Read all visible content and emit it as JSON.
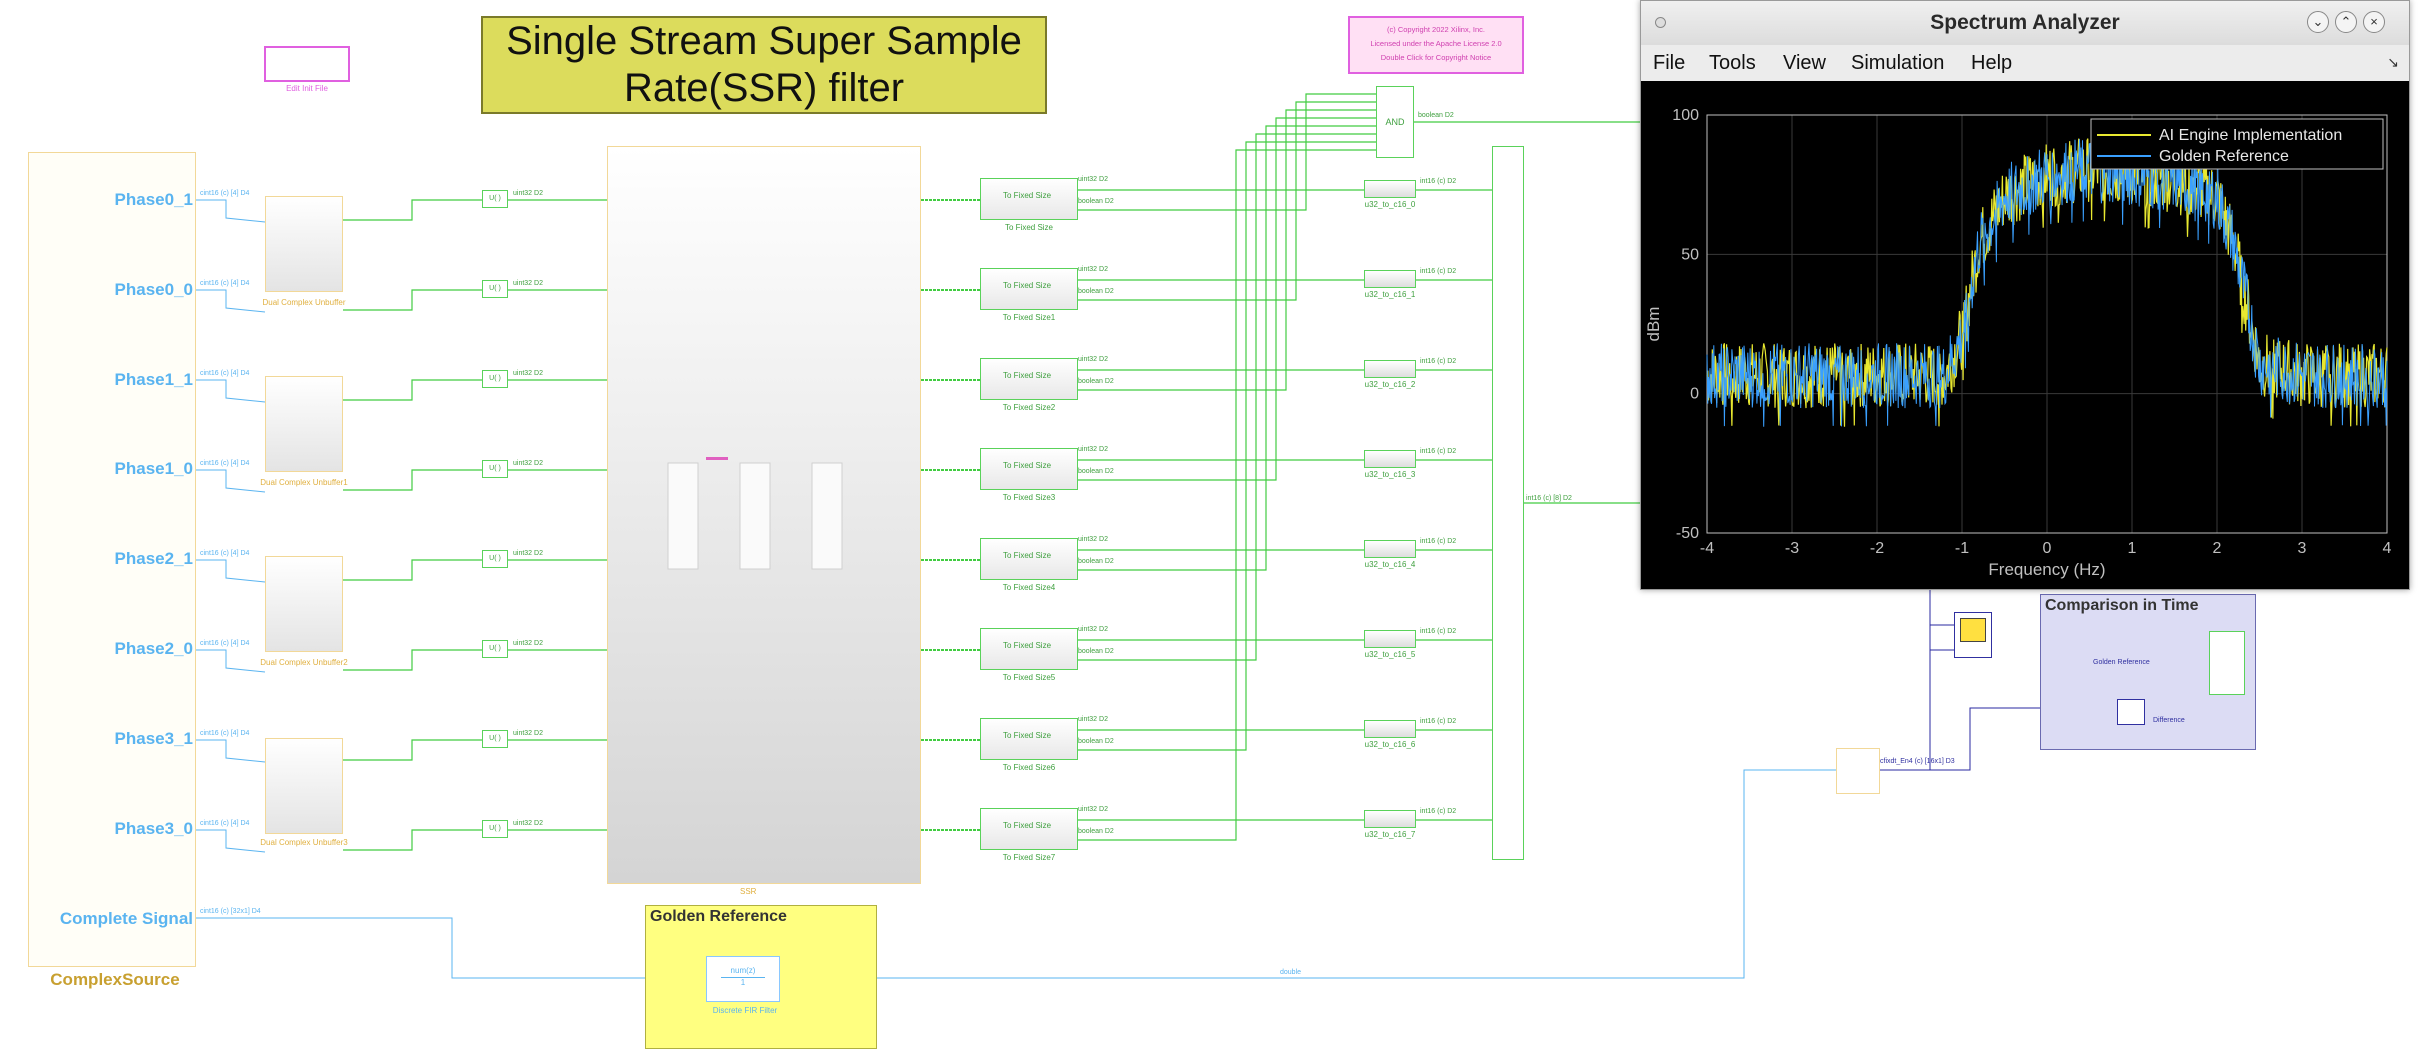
{
  "model": {
    "title": "Single Stream Super Sample Rate(SSR) filter",
    "copyright_lines": [
      "(c) Copyright 2022 Xilinx, Inc.",
      "Licensed under the Apache License 2.0",
      "Double Click for Copyright Notice"
    ],
    "edit_init_label": "Edit Init File",
    "source": {
      "title": "ComplexSource",
      "ports": [
        "Phase0_1",
        "Phase0_0",
        "Phase1_1",
        "Phase1_0",
        "Phase2_1",
        "Phase2_0",
        "Phase3_1",
        "Phase3_0",
        "Complete Signal"
      ]
    },
    "signal_labels": {
      "cint16_in": "cint16 (c) [4] D4",
      "uint32": "uint32 D2",
      "boolean": "boolean D2",
      "int16": "int16 (c) D2",
      "mux_out": "int16 (c) [8] D2",
      "complete": "cint16 (c) [32x1] D4",
      "double_out": "double",
      "boolean_and": "boolean D2",
      "diff_out": "cfixdt_En4 (c) [16x1] D3"
    },
    "unbuffer_labels": [
      "Dual Complex Unbuffer",
      "Dual Complex Unbuffer1",
      "Dual Complex Unbuffer2",
      "Dual Complex Unbuffer3"
    ],
    "ssr_label": "SSR",
    "to_fixed_size": {
      "inner": "To Fixed Size",
      "labels": [
        "To Fixed Size",
        "To Fixed Size1",
        "To Fixed Size2",
        "To Fixed Size3",
        "To Fixed Size4",
        "To Fixed Size5",
        "To Fixed Size6",
        "To Fixed Size7"
      ]
    },
    "u32_labels": [
      "u32_to_c16_0",
      "u32_to_c16_1",
      "u32_to_c16_2",
      "u32_to_c16_3",
      "u32_to_c16_4",
      "u32_to_c16_5",
      "u32_to_c16_6",
      "u32_to_c16_7"
    ],
    "and_label": "AND",
    "golden": {
      "title": "Golden Reference",
      "block_label": "Discrete FIR Filter",
      "tf": "num(z)"
    },
    "comparison": {
      "title": "Comparison in Time",
      "golden_label": "Golden Reference",
      "diff_label": "Difference"
    }
  },
  "spectrum_analyzer": {
    "title": "Spectrum Analyzer",
    "menu": [
      "File",
      "Tools",
      "View",
      "Simulation",
      "Help"
    ],
    "icon_colors": {
      "background": "#000000",
      "axes": "#c0c0c0",
      "ai_engine": "#e8e830",
      "golden": "#3aa0ff"
    }
  },
  "chart_data": {
    "type": "line",
    "xlabel": "Frequency (Hz)",
    "ylabel": "dBm",
    "xlim": [
      -4,
      4
    ],
    "ylim": [
      -50,
      100
    ],
    "xticks": [
      -4,
      -3,
      -2,
      -1,
      0,
      1,
      2,
      3,
      4
    ],
    "yticks": [
      -50,
      0,
      50,
      100
    ],
    "legend_position": "top-right",
    "series": [
      {
        "name": "AI Engine Implementation",
        "color": "#e8e830",
        "x": [
          -4,
          -3.5,
          -3,
          -2.5,
          -2,
          -1.5,
          -1.2,
          -1.0,
          -0.8,
          -0.5,
          0,
          0.5,
          1,
          1.5,
          2,
          2.2,
          2.5,
          3,
          3.5,
          4
        ],
        "y": [
          8,
          8,
          8,
          8,
          8,
          8,
          8,
          22,
          55,
          72,
          80,
          82,
          80,
          78,
          72,
          55,
          12,
          8,
          8,
          8
        ]
      },
      {
        "name": "Golden Reference",
        "color": "#3aa0ff",
        "x": [
          -4,
          -3.5,
          -3,
          -2.5,
          -2,
          -1.5,
          -1.2,
          -1.0,
          -0.8,
          -0.5,
          0,
          0.5,
          1,
          1.5,
          2,
          2.2,
          2.5,
          3,
          3.5,
          4
        ],
        "y": [
          8,
          8,
          8,
          8,
          8,
          8,
          8,
          22,
          55,
          72,
          80,
          82,
          80,
          78,
          72,
          55,
          12,
          8,
          8,
          8
        ]
      }
    ]
  }
}
